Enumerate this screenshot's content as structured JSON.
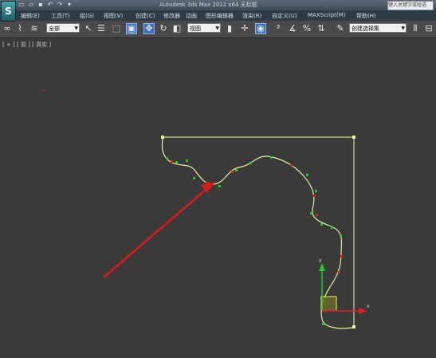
{
  "app": {
    "logo_text": "S",
    "title": "Autodesk 3ds Max  2012 x64    无标题",
    "help_search_placeholder": "键入关键字或短语"
  },
  "quick_access": [
    "new-icon",
    "open-icon",
    "save-icon",
    "undo-icon",
    "redo-icon",
    "dropdown-icon"
  ],
  "menu": [
    "编辑(E)",
    "工具(T)",
    "组(G)",
    "视图(V)",
    "创建(C)",
    "修改器",
    "动画",
    "图形编辑器",
    "渲染(R)",
    "自定义(U)",
    "MAXScript(M)",
    "帮助(H)"
  ],
  "toolbar": {
    "selection_filter": "全部",
    "coord_system": "视图",
    "named_selection": "创建选择集"
  },
  "viewport": {
    "label": "[ + ] [ 前 ] [ 真实 ]"
  },
  "colors": {
    "spline": "#e8f0a0",
    "vertex": "#22cc22",
    "segment_marker": "#e02020",
    "arrow": "#e01818",
    "gizmo_y": "#22cc22",
    "gizmo_x": "#e02020",
    "selection_box": "#f5f5a0"
  }
}
